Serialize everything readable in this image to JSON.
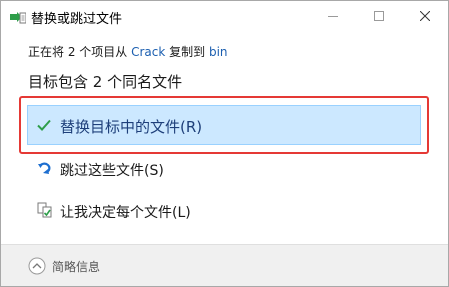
{
  "window": {
    "title": "替换或跳过文件"
  },
  "progress": {
    "prefix": "正在将 2 个项目从 ",
    "source": "Crack",
    "middle": " 复制到 ",
    "destination": "bin"
  },
  "heading": "目标包含 2 个同名文件",
  "options": [
    {
      "label": "替换目标中的文件(R)",
      "icon": "checkmark-icon",
      "selected": true
    },
    {
      "label": "跳过这些文件(S)",
      "icon": "skip-arrow-icon",
      "selected": false
    },
    {
      "label": "让我决定每个文件(L)",
      "icon": "compare-files-icon",
      "selected": false
    }
  ],
  "footer": {
    "details_label": "简略信息"
  },
  "colors": {
    "selected_bg": "#cce8ff",
    "highlight_border": "#e53935",
    "link": "#1c5fb0",
    "check_green": "#2e9e4a",
    "skip_blue": "#1e6fd0"
  }
}
